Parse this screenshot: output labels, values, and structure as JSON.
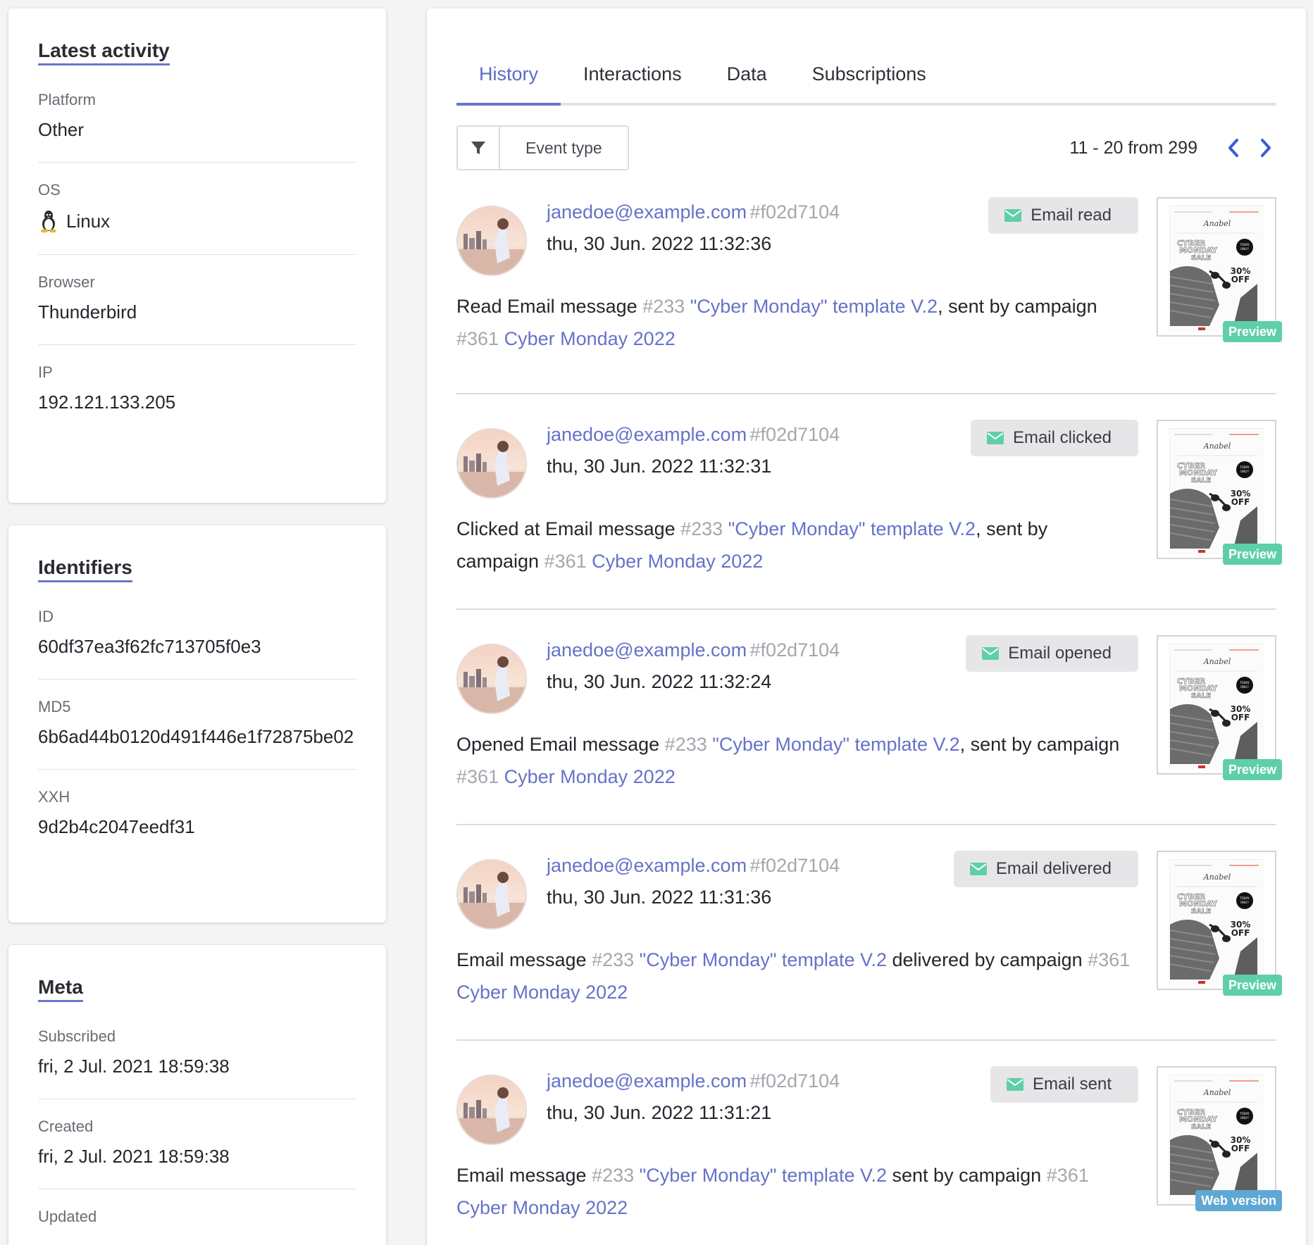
{
  "latest_activity": {
    "title": "Latest activity",
    "platform_label": "Platform",
    "platform_value": "Other",
    "os_label": "OS",
    "os_value": "Linux",
    "browser_label": "Browser",
    "browser_value": "Thunderbird",
    "ip_label": "IP",
    "ip_value": "192.121.133.205"
  },
  "identifiers": {
    "title": "Identifiers",
    "id_label": "ID",
    "id_value": "60df37ea3f62fc713705f0e3",
    "md5_label": "MD5",
    "md5_value": "6b6ad44b0120d491f446e1f72875be02",
    "xxh_label": "XXH",
    "xxh_value": "9d2b4c2047eedf31"
  },
  "meta": {
    "title": "Meta",
    "subscribed_label": "Subscribed",
    "subscribed_value": "fri, 2 Jul. 2021 18:59:38",
    "created_label": "Created",
    "created_value": "fri, 2 Jul. 2021 18:59:38",
    "updated_label": "Updated"
  },
  "tabs": [
    "History",
    "Interactions",
    "Data",
    "Subscriptions"
  ],
  "active_tab": "History",
  "filter": {
    "label": "Event type"
  },
  "pager": {
    "text": "11 - 20 from 299"
  },
  "colors": {
    "accent": "#6a77c9",
    "link": "#6572c8",
    "badge_icon": "#5fcfa8",
    "preview_tag": "#5fcfa8",
    "web_tag": "#5fa8d3"
  },
  "events": [
    {
      "email": "janedoe@example.com",
      "hash": "#f02d7104",
      "time": "thu, 30 Jun. 2022 11:32:36",
      "badge": "Email read",
      "d1": "Read Email message ",
      "d2": "#233",
      "d3": " \"Cyber Monday\" template V.2",
      "d4": ", sent by campaign ",
      "d5": "#361",
      "d6": " Cyber Monday 2022",
      "tag": "Preview",
      "tag_type": "preview"
    },
    {
      "email": "janedoe@example.com",
      "hash": "#f02d7104",
      "time": "thu, 30 Jun. 2022 11:32:31",
      "badge": "Email clicked",
      "d1": "Clicked at Email message ",
      "d2": "#233",
      "d3": " \"Cyber Monday\" template V.2",
      "d4": ", sent by campaign ",
      "d5": "#361",
      "d6": " Cyber Monday 2022",
      "tag": "Preview",
      "tag_type": "preview"
    },
    {
      "email": "janedoe@example.com",
      "hash": "#f02d7104",
      "time": "thu, 30 Jun. 2022 11:32:24",
      "badge": "Email opened",
      "d1": "Opened Email message ",
      "d2": "#233",
      "d3": " \"Cyber Monday\" template V.2",
      "d4": ", sent by campaign ",
      "d5": "#361",
      "d6": " Cyber Monday 2022",
      "tag": "Preview",
      "tag_type": "preview"
    },
    {
      "email": "janedoe@example.com",
      "hash": "#f02d7104",
      "time": "thu, 30 Jun. 2022 11:31:36",
      "badge": "Email delivered",
      "d1": "Email message ",
      "d2": "#233",
      "d3": " \"Cyber Monday\" template V.2",
      "d4": " delivered by campaign ",
      "d5": "#361",
      "d6": " Cyber Monday 2022",
      "tag": "Preview",
      "tag_type": "preview"
    },
    {
      "email": "janedoe@example.com",
      "hash": "#f02d7104",
      "time": "thu, 30 Jun. 2022 11:31:21",
      "badge": "Email sent",
      "d1": "Email message ",
      "d2": "#233",
      "d3": " \"Cyber Monday\" template V.2",
      "d4": " sent by campaign ",
      "d5": "#361",
      "d6": " Cyber Monday 2022",
      "tag": "Web version",
      "tag_type": "web"
    }
  ],
  "thumbnail": {
    "brand": "Anabel",
    "sale_line1": "CYBER",
    "sale_line2": "MONDAY",
    "sale_line3": "SALE",
    "today_line1": "TODAY",
    "today_line2": "ONLY!",
    "discount_line1": "30%",
    "discount_line2": "OFF"
  }
}
